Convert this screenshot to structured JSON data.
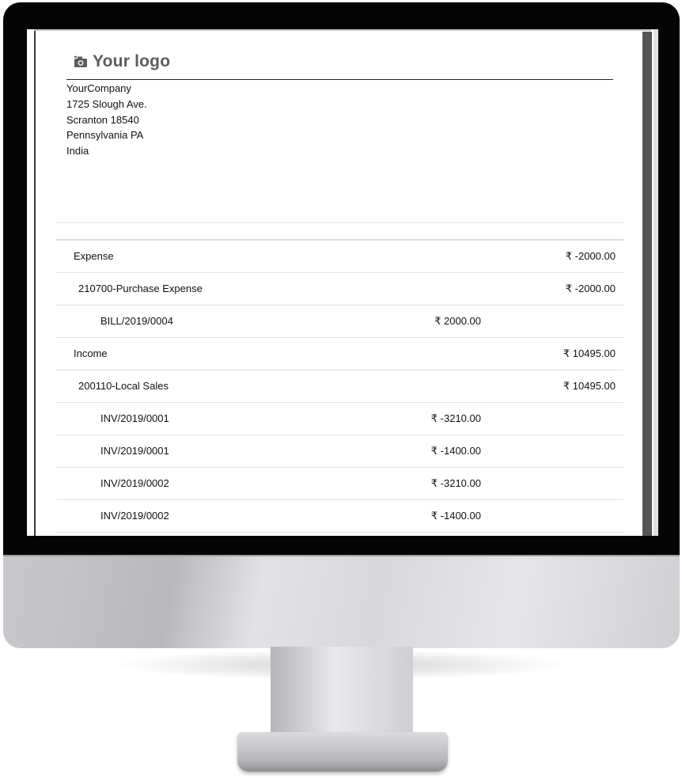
{
  "logo": {
    "text": "Your logo",
    "icon": "camera-icon"
  },
  "company": {
    "lines": [
      "YourCompany",
      "1725 Slough Ave.",
      "Scranton 18540",
      "Pennsylvania PA",
      "India"
    ]
  },
  "report": {
    "rows": [
      {
        "name": "Expense",
        "level": 0,
        "mid": "",
        "right": "₹ -2000.00"
      },
      {
        "name": "210700-Purchase Expense",
        "level": 1,
        "mid": "",
        "right": "₹ -2000.00"
      },
      {
        "name": "BILL/2019/0004",
        "level": 2,
        "mid": "₹ 2000.00",
        "right": ""
      },
      {
        "name": "Income",
        "level": 0,
        "mid": "",
        "right": "₹ 10495.00"
      },
      {
        "name": "200110-Local Sales",
        "level": 1,
        "mid": "",
        "right": "₹ 10495.00"
      },
      {
        "name": "INV/2019/0001",
        "level": 2,
        "mid": "₹ -3210.00",
        "right": ""
      },
      {
        "name": "INV/2019/0001",
        "level": 2,
        "mid": "₹ -1400.00",
        "right": ""
      },
      {
        "name": "INV/2019/0002",
        "level": 2,
        "mid": "₹ -3210.00",
        "right": ""
      },
      {
        "name": "INV/2019/0002",
        "level": 2,
        "mid": "₹ -1400.00",
        "right": ""
      }
    ]
  }
}
